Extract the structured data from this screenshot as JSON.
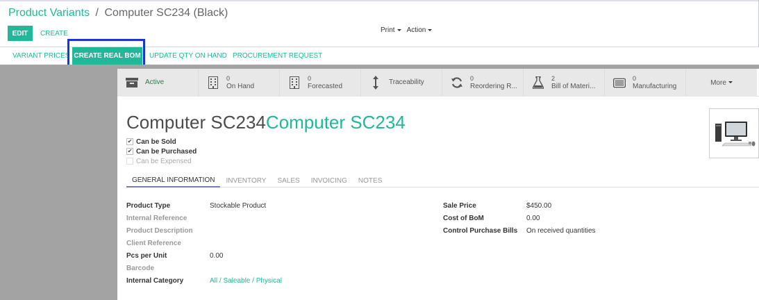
{
  "breadcrumb": {
    "parent": "Product Variants",
    "separator": "/",
    "current": "Computer SC234 (Black)"
  },
  "control": {
    "edit": "EDIT",
    "create": "CREATE",
    "print": "Print",
    "action": "Action"
  },
  "statusbar": {
    "variant_prices": "VARIANT PRICES",
    "create_real_bom": "CREATE REAL BOM",
    "update_qty": "UPDATE QTY ON HAND",
    "procurement": "PROCUREMENT REQUEST"
  },
  "smart_buttons": [
    {
      "icon": "archive-icon",
      "value": "",
      "label": "Active"
    },
    {
      "icon": "building-icon",
      "value": "0",
      "label": "On Hand"
    },
    {
      "icon": "building-icon",
      "value": "0",
      "label": "Forecasted"
    },
    {
      "icon": "arrows-vertical-icon",
      "value": "",
      "label": "Traceability"
    },
    {
      "icon": "refresh-icon",
      "value": "0",
      "label": "Reordering R..."
    },
    {
      "icon": "flask-icon",
      "value": "2",
      "label": "Bill of Materi..."
    },
    {
      "icon": "list-alt-icon",
      "value": "0",
      "label": "Manufacturing"
    },
    {
      "icon": "",
      "value": "",
      "label": "More"
    }
  ],
  "product": {
    "name": "Computer SC234",
    "variant_name": "Computer SC234"
  },
  "checkboxes": {
    "can_be_sold": {
      "label": "Can be Sold",
      "checked": true
    },
    "can_be_purchased": {
      "label": "Can be Purchased",
      "checked": true
    },
    "can_be_expensed": {
      "label": "Can be Expensed",
      "checked": false
    }
  },
  "tabs": [
    "GENERAL INFORMATION",
    "INVENTORY",
    "SALES",
    "INVOICING",
    "NOTES"
  ],
  "left_fields": [
    {
      "label": "Product Type",
      "value": "Stockable Product"
    },
    {
      "label": "Internal Reference",
      "value": ""
    },
    {
      "label": "Product Description",
      "value": ""
    },
    {
      "label": "Client Reference",
      "value": ""
    },
    {
      "label": "Pcs per Unit",
      "value": "0.00"
    },
    {
      "label": "Barcode",
      "value": ""
    },
    {
      "label": "Internal Category",
      "value": "All / Saleable / Physical"
    }
  ],
  "right_fields": [
    {
      "label": "Sale Price",
      "value": "$450.00"
    },
    {
      "label": "Cost of BoM",
      "value": "0.00"
    },
    {
      "label": "Control Purchase Bills",
      "value": "On received quantities"
    }
  ],
  "colors": {
    "accent": "#21b799",
    "highlight_border": "#1a34d6",
    "tab_underline": "#7c7bad"
  }
}
